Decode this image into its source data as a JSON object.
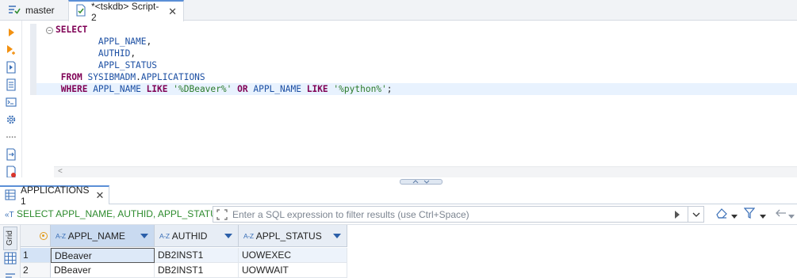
{
  "tabs": {
    "master_label": "master",
    "script_label": "*<tskdb> Script-2"
  },
  "editor": {
    "lines": [
      [
        {
          "t": "kw",
          "v": "SELECT"
        }
      ],
      [
        {
          "t": "pl",
          "v": "        "
        },
        {
          "t": "id",
          "v": "APPL_NAME"
        },
        {
          "t": "pl",
          "v": ","
        }
      ],
      [
        {
          "t": "pl",
          "v": "        "
        },
        {
          "t": "id",
          "v": "AUTHID"
        },
        {
          "t": "pl",
          "v": ","
        }
      ],
      [
        {
          "t": "pl",
          "v": "        "
        },
        {
          "t": "id",
          "v": "APPL_STATUS"
        }
      ],
      [
        {
          "t": "pl",
          "v": " "
        },
        {
          "t": "kw",
          "v": "FROM"
        },
        {
          "t": "pl",
          "v": " "
        },
        {
          "t": "id",
          "v": "SYSIBMADM"
        },
        {
          "t": "pl",
          "v": "."
        },
        {
          "t": "id",
          "v": "APPLICATIONS"
        }
      ],
      [
        {
          "t": "pl",
          "v": " "
        },
        {
          "t": "kw",
          "v": "WHERE"
        },
        {
          "t": "pl",
          "v": " "
        },
        {
          "t": "id",
          "v": "APPL_NAME"
        },
        {
          "t": "pl",
          "v": " "
        },
        {
          "t": "kw",
          "v": "LIKE"
        },
        {
          "t": "pl",
          "v": " "
        },
        {
          "t": "str",
          "v": "'%DBeaver%'"
        },
        {
          "t": "pl",
          "v": " "
        },
        {
          "t": "kw",
          "v": "OR"
        },
        {
          "t": "pl",
          "v": " "
        },
        {
          "t": "id",
          "v": "APPL_NAME"
        },
        {
          "t": "pl",
          "v": " "
        },
        {
          "t": "kw",
          "v": "LIKE"
        },
        {
          "t": "pl",
          "v": " "
        },
        {
          "t": "str",
          "v": "'%python%'"
        },
        {
          "t": "pl",
          "v": ";"
        }
      ]
    ]
  },
  "results": {
    "tab_label": "APPLICATIONS 1",
    "query_label": "SELECT APPL_NAME, AUTHID, APPL_STATUS",
    "filter_placeholder": "Enter a SQL expression to filter results (use Ctrl+Space)",
    "grid_label": "Grid",
    "columns": [
      "APPL_NAME",
      "AUTHID",
      "APPL_STATUS"
    ],
    "rows": [
      {
        "num": "1",
        "cells": [
          "DBeaver",
          "DB2INST1",
          "UOWEXEC"
        ]
      },
      {
        "num": "2",
        "cells": [
          "DBeaver",
          "DB2INST1",
          "UOWWAIT"
        ]
      }
    ],
    "az_icon_text": "A-Z"
  },
  "colors": {
    "keyword": "#7f0055",
    "identifier": "#1c4fa3",
    "string": "#2a7a2a",
    "query_label": "#2e8b2e"
  }
}
